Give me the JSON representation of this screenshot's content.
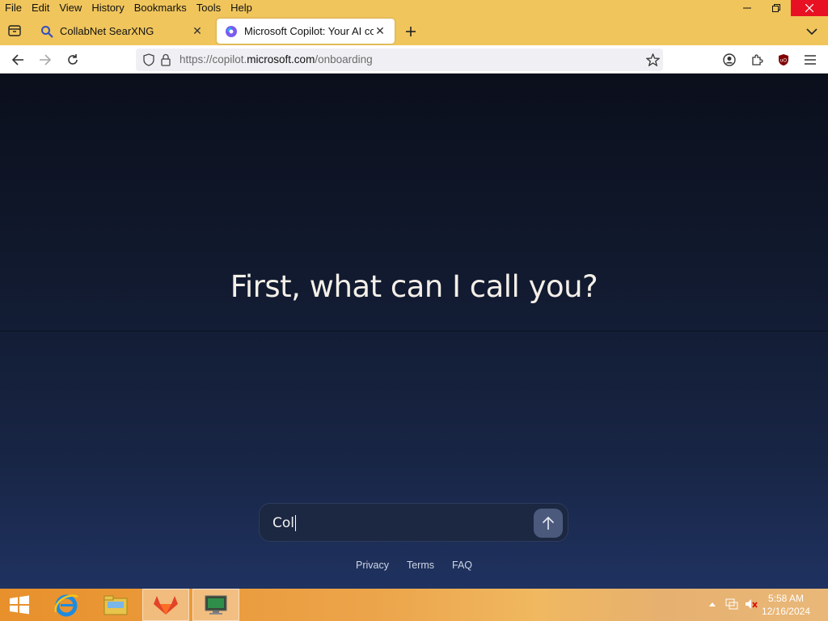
{
  "menubar": {
    "items": [
      "File",
      "Edit",
      "View",
      "History",
      "Bookmarks",
      "Tools",
      "Help"
    ]
  },
  "tabs": [
    {
      "title": "CollabNet SearXNG",
      "icon": "magnifier-icon",
      "active": false
    },
    {
      "title": "Microsoft Copilot: Your AI com",
      "icon": "copilot-icon",
      "active": true
    }
  ],
  "navbar": {
    "url_prefix": "https://copilot.",
    "url_domain": "microsoft.com",
    "url_path": "/onboarding"
  },
  "page": {
    "heading": "First, what can I call you?",
    "input_value": "Col",
    "footer_links": [
      "Privacy",
      "Terms",
      "FAQ"
    ]
  },
  "taskbar": {
    "time": "5:58 AM",
    "date": "12/16/2024"
  },
  "colors": {
    "browser_chrome": "#f0c55c",
    "page_top": "#0b0f1c",
    "page_bottom": "#1f3260",
    "close_button": "#e81123"
  }
}
